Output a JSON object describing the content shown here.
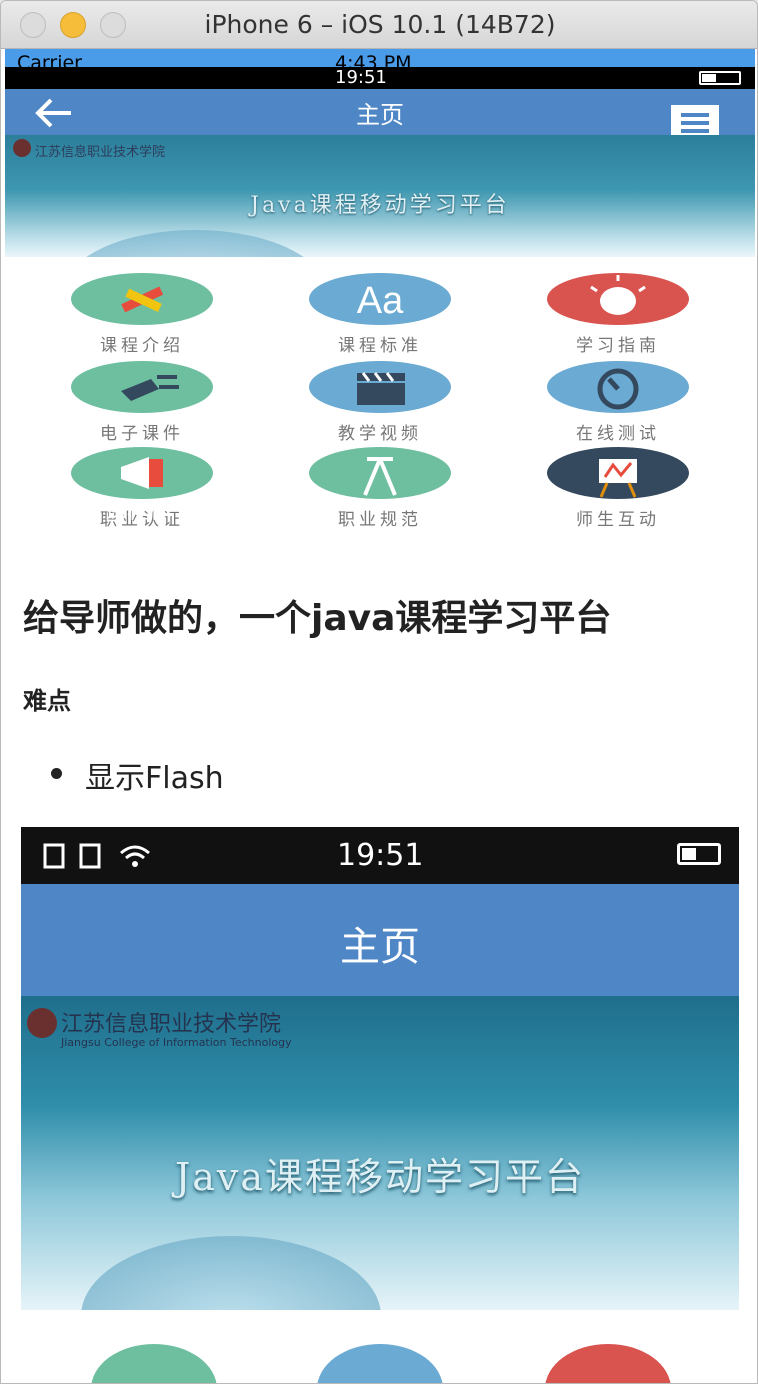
{
  "window": {
    "title": "iPhone 6 – iOS 10.1 (14B72)"
  },
  "sim_status": {
    "carrier": "Carrier",
    "time": "4:43 PM"
  },
  "phone_status": {
    "time": "19:51"
  },
  "navbar": {
    "title": "主页",
    "back_icon": "arrow-left-icon",
    "menu_icon": "message-menu-icon"
  },
  "banner": {
    "school": "江苏信息职业技术学院",
    "title": "Java课程移动学习平台"
  },
  "grid": {
    "items": [
      {
        "label": "课程介绍",
        "color": "#6dbfa0",
        "icon": "pencil-icon"
      },
      {
        "label": "课程标准",
        "color": "#6aaad3",
        "icon": "text-aa-icon"
      },
      {
        "label": "学习指南",
        "color": "#d9534f",
        "icon": "lightbulb-icon"
      },
      {
        "label": "电子课件",
        "color": "#6dbfa0",
        "icon": "plug-icon"
      },
      {
        "label": "教学视频",
        "color": "#6aaad3",
        "icon": "clapper-icon"
      },
      {
        "label": "在线测试",
        "color": "#6aaad3",
        "icon": "timer-icon"
      },
      {
        "label": "职业认证",
        "color": "#6dbfa0",
        "icon": "megaphone-icon"
      },
      {
        "label": "职业规范",
        "color": "#6dbfa0",
        "icon": "compass-icon"
      },
      {
        "label": "师生互动",
        "color": "#34495e",
        "icon": "easel-icon"
      }
    ],
    "overlay_text": "课程移"
  },
  "article": {
    "heading": "给导师做的，一个java课程学习平台",
    "subheading": "难点",
    "bullet": "显示Flash"
  },
  "screenshot": {
    "time": "19:51",
    "nav_title": "主页",
    "school": "江苏信息职业技术学院",
    "school_en": "Jiangsu College of Information Technology",
    "banner_title": "Java课程移动学习平台"
  }
}
